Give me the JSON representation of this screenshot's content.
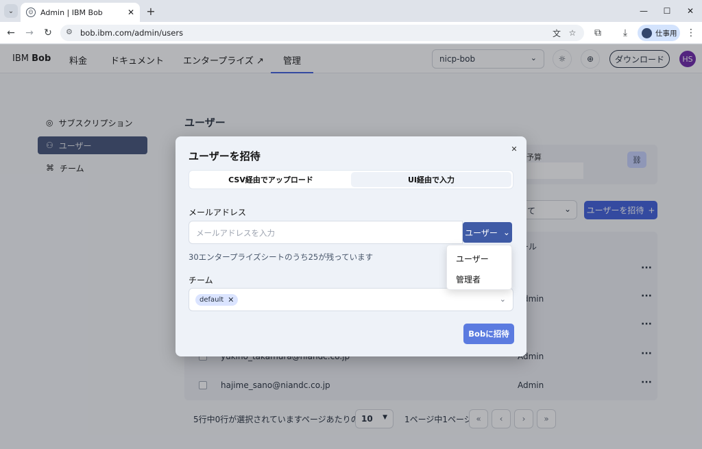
{
  "browser": {
    "tab_title": "Admin | IBM Bob",
    "url": "bob.ibm.com/admin/users",
    "profile_label": "仕事用"
  },
  "app": {
    "brand_prefix": "IBM",
    "brand_name": "Bob",
    "nav": [
      {
        "label": "料金"
      },
      {
        "label": "ドキュメント"
      },
      {
        "label": "エンタープライズ ↗"
      },
      {
        "label": "管理"
      }
    ],
    "org_select": "nicp-bob",
    "download_label": "ダウンロード",
    "avatar_initials": "HS",
    "sidebar": [
      {
        "label": "サブスクリプション"
      },
      {
        "label": "ユーザー"
      },
      {
        "label": "チーム"
      }
    ],
    "page_title": "ユーザー",
    "card_label_fragment": "予算",
    "filter_fragment": "て",
    "invite_button": "ユーザーを招待",
    "table": {
      "role_header_fragment": "ール",
      "rows": [
        {
          "email": "",
          "role": "er"
        },
        {
          "email": "",
          "role": "Admin"
        },
        {
          "email": "",
          "role": "er"
        },
        {
          "email": "yukino_takamura@niandc.co.jp",
          "role": "Admin"
        },
        {
          "email": "hajime_sano@niandc.co.jp",
          "role": "Admin"
        }
      ]
    },
    "pager": {
      "selection_text": "5行中0行が選択されています",
      "per_page_label": "ページあたりの行数",
      "page_size": "10",
      "page_info": "1ページ中1ページ"
    }
  },
  "modal": {
    "title": "ユーザーを招待",
    "tabs": [
      {
        "label": "CSV経由でアップロード",
        "active": true
      },
      {
        "label": "UI経由で入力",
        "active": false
      }
    ],
    "email_label": "メールアドレス",
    "email_placeholder": "メールアドレスを入力",
    "role_button": "ユーザー",
    "seats_hint": "30エンタープライズシートのうち25が残っています",
    "team_label": "チーム",
    "team_chip": "default",
    "submit_label": "Bobに招待"
  },
  "role_dropdown": {
    "options": [
      "ユーザー",
      "管理者"
    ]
  }
}
